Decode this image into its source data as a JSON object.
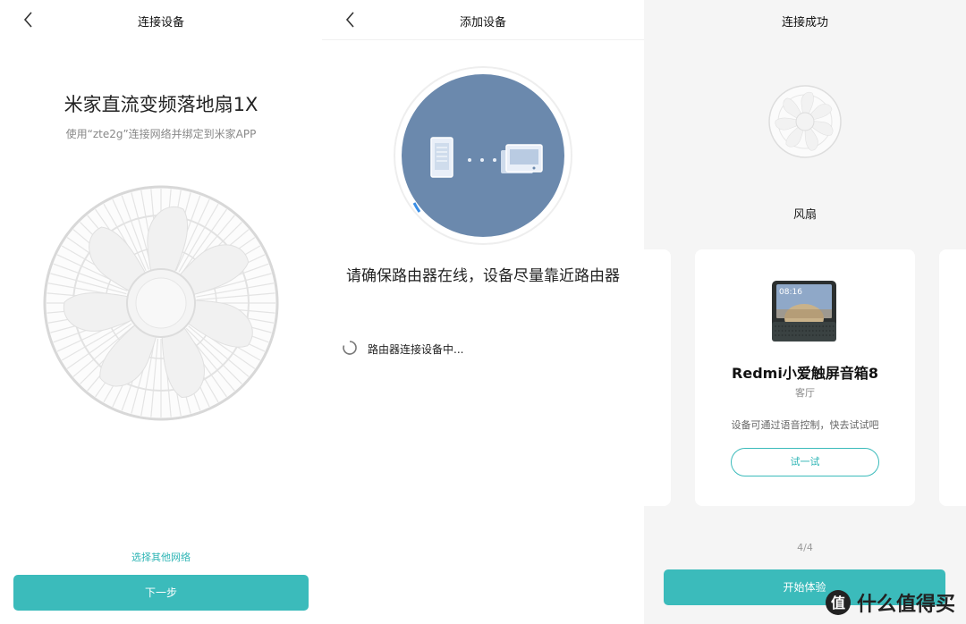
{
  "screen1": {
    "title": "连接设备",
    "device_name": "米家直流变频落地扇1X",
    "subtitle": "使用“zte2g”连接网络并绑定到米家APP",
    "other_network_link": "选择其他网络",
    "next_button": "下一步"
  },
  "screen2": {
    "title": "添加设备",
    "message": "请确保路由器在线，设备尽量靠近路由器",
    "status_text": "路由器连接设备中..."
  },
  "screen3": {
    "title": "连接成功",
    "device_label": "风扇",
    "card": {
      "device_name": "Redmi小爱触屏音箱8",
      "room": "客厅",
      "screen_time": "08:16",
      "description": "设备可通过语音控制，快去试试吧",
      "try_button": "试一试"
    },
    "page_indicator": "4/4",
    "start_button": "开始体验"
  },
  "watermark": "什么值得买",
  "colors": {
    "accent": "#3bbbbb",
    "link": "#2cb4b4",
    "illustration_circle": "#6b89ad"
  }
}
